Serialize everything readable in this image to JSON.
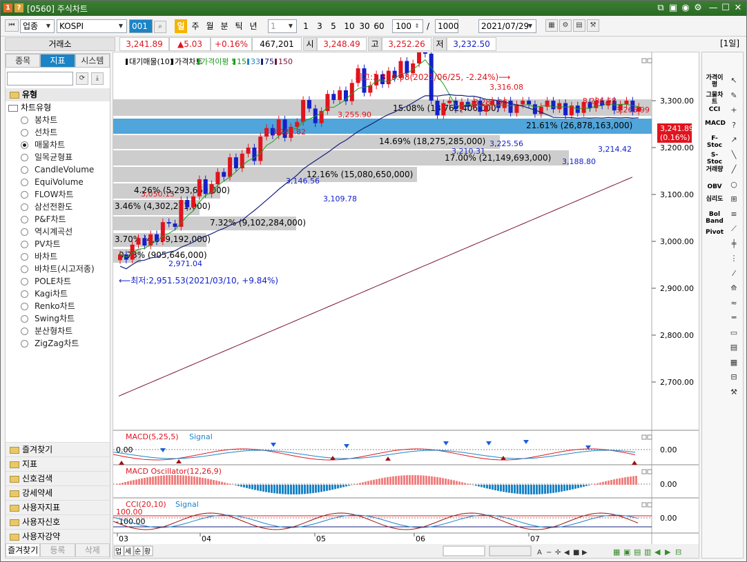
{
  "window": {
    "title": "[0560] 주식차트",
    "icon_left": "1",
    "icon_help": "?"
  },
  "toolbar": {
    "category": "업종",
    "symbol": "KOSPI",
    "code_input": "001",
    "periods": [
      "일",
      "주",
      "월",
      "분",
      "틱",
      "년"
    ],
    "active_period": "일",
    "interval_select": "1",
    "quick_intervals": [
      "1",
      "3",
      "5",
      "10",
      "30",
      "60"
    ],
    "count": "100",
    "total": "1000",
    "slash": "/",
    "date": "2021/07/29"
  },
  "pricebar": {
    "market": "거래소",
    "current": "3,241.89",
    "change": "▲5.03",
    "change_pct": "+0.16%",
    "volume": "467,201",
    "open_label": "시",
    "open": "3,248.49",
    "high_label": "고",
    "high": "3,252.26",
    "low_label": "저",
    "low": "3,232.50",
    "period_badge": "[1일]"
  },
  "leftpanel": {
    "tabs": [
      "종목",
      "지표",
      "시스템"
    ],
    "active_tab": "지표",
    "section": "유형",
    "group": "차트유형",
    "chart_types": [
      "봉차트",
      "선차트",
      "매물차트",
      "일목균형표",
      "CandleVolume",
      "EquiVolume",
      "FLOW차트",
      "삼선전환도",
      "P&F차트",
      "역시계곡선",
      "PV차트",
      "바차트",
      "바차트(시고저종)",
      "POLE차트",
      "Kagi차트",
      "Renko차트",
      "Swing차트",
      "분산형차트",
      "ZigZag차트"
    ],
    "selected_type": "매물차트",
    "folders": [
      "즐겨찾기",
      "지표",
      "신호검색",
      "강세약세",
      "사용자지표",
      "사용자신호",
      "사용자강약"
    ],
    "bottom_tabs": [
      "즐겨찾기",
      "등록",
      "삭제"
    ]
  },
  "chart": {
    "legend": [
      "대기매물(10)",
      "가격차트",
      "가격이평 5",
      "15",
      "33",
      "75",
      "150"
    ],
    "y_ticks": [
      "3,300.00",
      "3,200.00",
      "3,100.00",
      "3,000.00",
      "2,900.00",
      "2,800.00",
      "2,700.00"
    ],
    "x_ticks": [
      "03",
      "04",
      "05",
      "06",
      "07"
    ],
    "last_price": "3,241.89",
    "last_pct": "(0.16%)",
    "high_note": "최고:3,316.08(2021/06/25, -2.24%)⟶",
    "low_note": "⟵최저:2,951.53(2021/03/10, +9.84%)",
    "profile": [
      "15.08% (18,762,406,000)",
      "21.61% (26,878,163,000)",
      "14.69% (18,275,285,000)",
      "17.00% (21,149,693,000)",
      "12.16% (15,080,650,000)",
      "4.26% (5,293,659,000)",
      "3.46% (4,302,271,000)",
      "7.32% (9,102,284,000)",
      "3.70% (4,599,192,000)",
      "0.73% (905,646,000)"
    ],
    "price_labels": [
      "3,316.08",
      "3,281.96",
      "3,286.58",
      "3,265.99",
      "3,255.90",
      "3,220.82",
      "3,225.56",
      "3,210.31",
      "3,214.42",
      "3,188.80",
      "3,146.56",
      "3,109.78",
      "3,050.15",
      "2,971.04"
    ]
  },
  "sub_panels": [
    {
      "title": "MACD(5,25,5)",
      "signal": "Signal",
      "value": "0.00",
      "level_label": "0.00"
    },
    {
      "title": "MACD Oscillator(12,26,9)",
      "value": "0.00"
    },
    {
      "title": "CCI(20,10)",
      "signal": "Signal",
      "value": "0.00",
      "upper": "100.00",
      "lower": "-100.00"
    }
  ],
  "bottombar": {
    "tabs": [
      "업",
      "세",
      "순",
      "황"
    ]
  },
  "rightbar": {
    "indicators": [
      "가격이평",
      "그물차트",
      "CCI",
      "MACD",
      "F-Stoc",
      "S-Stoc",
      "거래량",
      "OBV",
      "심리도",
      "Bol Band",
      "Pivot"
    ]
  },
  "colors": {
    "title_green": "#2e7028",
    "up": "#e0141e",
    "down": "#1420c8",
    "accent_blue": "#1a84c7",
    "profile_hi": "#3d9bd6",
    "profile_gray": "#c8c8c8"
  }
}
